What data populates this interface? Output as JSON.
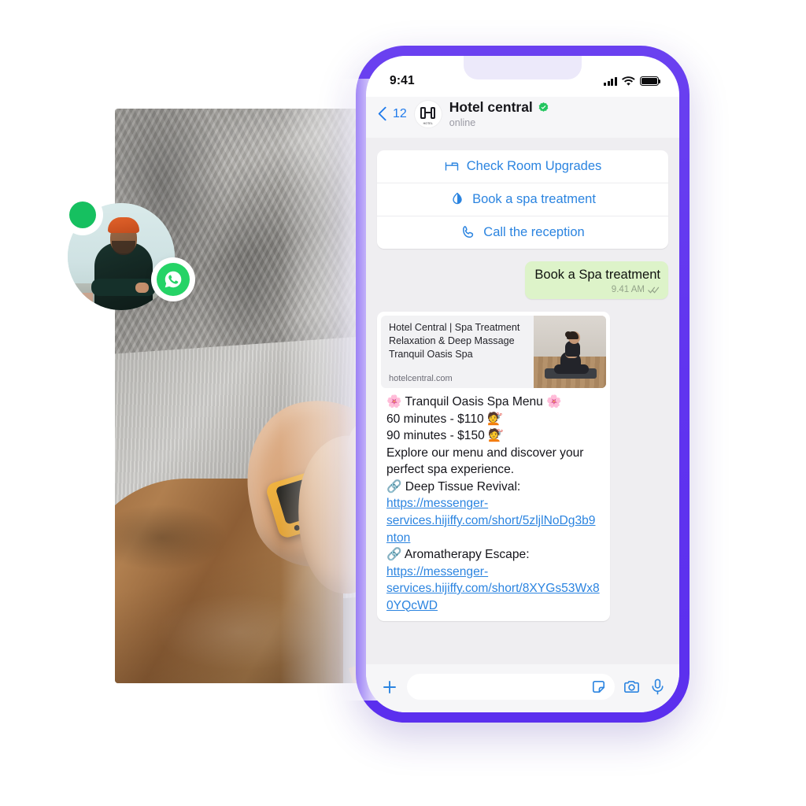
{
  "phone": {
    "frame_color": "#6034ef",
    "status_bar": {
      "time": "9:41",
      "signal_icon": "signal-bars-icon",
      "wifi_icon": "wifi-icon",
      "battery_icon": "battery-full-icon"
    },
    "chat_header": {
      "back_icon": "chevron-left-icon",
      "back_count": "12",
      "avatar_icon": "hotel-monogram-icon",
      "avatar_caption": "HOTEL",
      "title": "Hotel central",
      "verified_icon": "verified-badge-icon",
      "verified_color": "#22c55e",
      "status": "online"
    },
    "quick_replies": [
      {
        "label": "Check Room Upgrades",
        "icon": "bed-icon"
      },
      {
        "label": "Book a spa treatment",
        "icon": "spa-leaf-icon"
      },
      {
        "label": "Call the reception",
        "icon": "phone-handset-icon"
      }
    ],
    "outgoing_message": {
      "text": "Book a Spa treatment",
      "time": "9.41 AM",
      "status_icon": "double-check-icon",
      "bubble_color": "#ddf3c9"
    },
    "incoming_message": {
      "link_preview": {
        "title": "Hotel Central | Spa Treatment Relaxation & Deep Massage Tranquil Oasis Spa",
        "domain": "hotelcentral.com",
        "thumbnail_icon": "yoga-meditation-photo"
      },
      "lines": [
        {
          "id": "l1",
          "text": "🌸 Tranquil Oasis Spa Menu 🌸"
        },
        {
          "id": "l2",
          "text": "60 minutes - $110 💇"
        },
        {
          "id": "l3",
          "text": "90 minutes - $150 💇"
        },
        {
          "id": "l4",
          "text": "Explore our menu and discover your perfect spa experience."
        }
      ],
      "links": [
        {
          "id": "k1",
          "icon": "🔗",
          "label": "Deep Tissue Revival:",
          "url": "https://messenger-services.hijiffy.com/short/5zljlNoDg3b9nton"
        },
        {
          "id": "k2",
          "icon": "🔗",
          "label": "Aromatherapy Escape:",
          "url": "https://messenger-services.hijiffy.com/short/8XYGs53Wx80YQcWD"
        }
      ],
      "link_color": "#2b84e0"
    },
    "input_bar": {
      "add_icon": "plus-icon",
      "input_value": "",
      "input_placeholder": "",
      "sticker_icon": "sticker-icon",
      "camera_icon": "camera-icon",
      "mic_icon": "microphone-icon"
    }
  },
  "collage": {
    "photo_caption": "person-holding-phone-photo",
    "avatar_caption": "man-in-orange-beanie-avatar",
    "status_dot_color": "#16c060",
    "whatsapp_badge": {
      "icon": "whatsapp-icon",
      "color": "#25d366"
    }
  }
}
